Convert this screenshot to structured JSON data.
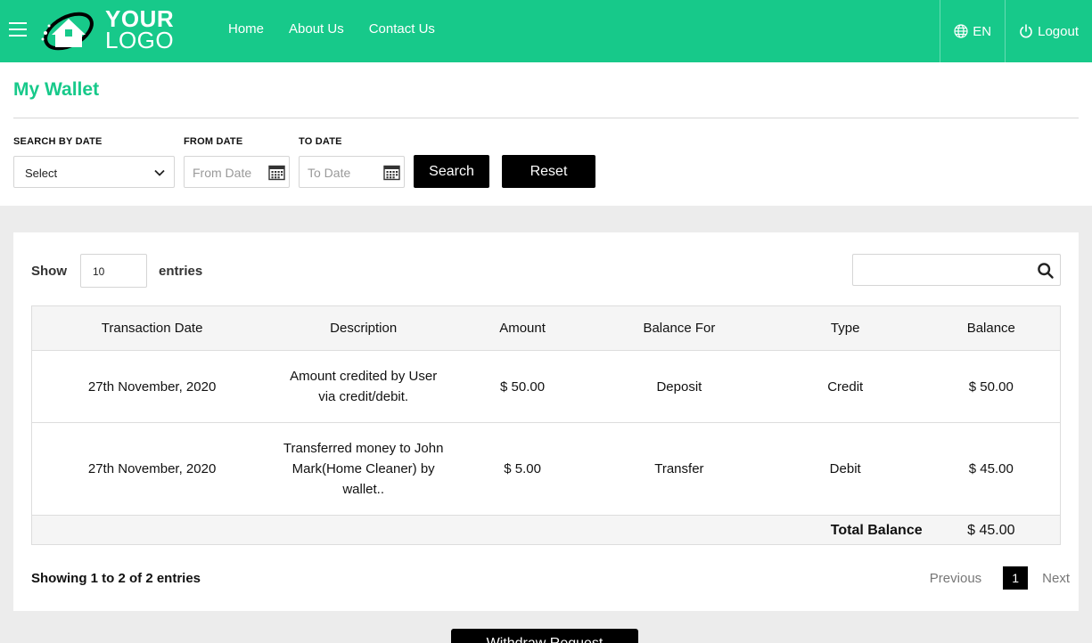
{
  "header": {
    "logo_line1": "YOUR",
    "logo_line2": "LOGO",
    "nav": [
      "Home",
      "About Us",
      "Contact Us"
    ],
    "language": "EN",
    "logout": "Logout",
    "icons": [
      "hamburger-icon",
      "globe-icon",
      "power-icon"
    ],
    "brand_color": "#17c98a"
  },
  "page": {
    "title": "My Wallet"
  },
  "filters": {
    "search_by_date_label": "SEARCH BY DATE",
    "select_value": "Select",
    "from_date_label": "FROM DATE",
    "from_date_placeholder": "From Date",
    "to_date_label": "TO DATE",
    "to_date_placeholder": "To Date",
    "search_button": "Search",
    "reset_button": "Reset"
  },
  "table_controls": {
    "show_label": "Show",
    "length_value": "10",
    "entries_label": "entries"
  },
  "table": {
    "columns": [
      "Transaction Date",
      "Description",
      "Amount",
      "Balance For",
      "Type",
      "Balance"
    ],
    "rows": [
      [
        "27th November, 2020",
        "Amount credited by User via credit/debit.",
        "$ 50.00",
        "Deposit",
        "Credit",
        "$ 50.00"
      ],
      [
        "27th November, 2020",
        "Transferred money to John Mark(Home Cleaner) by wallet..",
        "$ 5.00",
        "Transfer",
        "Debit",
        "$ 45.00"
      ]
    ],
    "footer_label": "Total Balance",
    "footer_value": "$ 45.00"
  },
  "pagination": {
    "info": "Showing 1 to 2 of 2 entries",
    "previous": "Previous",
    "current": "1",
    "next": "Next"
  },
  "withdraw_button": "Withdraw Request"
}
